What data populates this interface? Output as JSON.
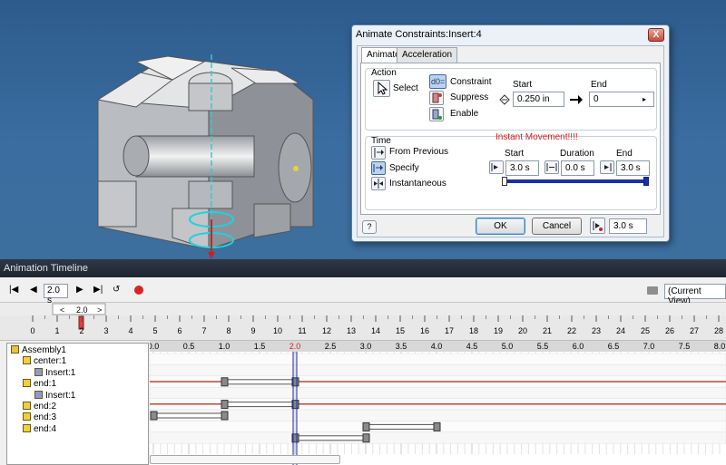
{
  "dialog": {
    "title": "Animate Constraints:Insert:4",
    "close_label": "X",
    "tabs": [
      {
        "label": "Animate"
      },
      {
        "label": "Acceleration"
      }
    ],
    "action": {
      "group_label": "Action",
      "select_label": "Select",
      "options": [
        {
          "label": "Constraint"
        },
        {
          "label": "Suppress"
        },
        {
          "label": "Enable"
        }
      ],
      "constraint_icon_text": "d0=",
      "start_label": "Start",
      "start_value": "0.250 in",
      "end_label": "End",
      "end_value": "0"
    },
    "time": {
      "group_label": "Time",
      "annotation": "Instant Movement!!!!",
      "annotation_color": "#d21f1f",
      "options": [
        {
          "label": "From Previous"
        },
        {
          "label": "Specify"
        },
        {
          "label": "Instantaneous"
        }
      ],
      "start_label": "Start",
      "start_value": "3.0 s",
      "duration_label": "Duration",
      "duration_value": "0.0 s",
      "end_label": "End",
      "end_value": "3.0 s"
    },
    "help_label": "?",
    "ok_label": "OK",
    "cancel_label": "Cancel",
    "footer_time": "3.0 s"
  },
  "timeline": {
    "title": "Animation Timeline",
    "current_time": "2.0 s",
    "view": "(Current View)",
    "ruler": {
      "marker_value": "2.0",
      "left_arrow": "<",
      "right_arrow": ">",
      "ticks": [
        "0",
        "1",
        "2",
        "3",
        "4",
        "5",
        "6",
        "7",
        "8",
        "9",
        "10",
        "11",
        "12",
        "13",
        "14",
        "15",
        "16",
        "17",
        "18",
        "19",
        "20",
        "21",
        "22",
        "23",
        "24",
        "25",
        "26",
        "27",
        "28"
      ]
    },
    "scale_labels": [
      "0.0",
      "0.5",
      "1.0",
      "1.5",
      "2.0",
      "2.5",
      "3.0",
      "3.5",
      "4.0",
      "4.5",
      "5.0",
      "5.5",
      "6.0",
      "6.5",
      "7.0",
      "7.5",
      "8.0"
    ],
    "current_scale_label": "2.0",
    "tree": [
      {
        "label": "Assembly1",
        "level": 0,
        "icon": "assembly-icon"
      },
      {
        "label": "center:1",
        "level": 1,
        "icon": "part-icon"
      },
      {
        "label": "Insert:1",
        "level": 2,
        "icon": "constraint-icon"
      },
      {
        "label": "end:1",
        "level": 1,
        "icon": "part-icon"
      },
      {
        "label": "Insert:1",
        "level": 2,
        "icon": "constraint-icon"
      },
      {
        "label": "end:2",
        "level": 1,
        "icon": "part-icon"
      },
      {
        "label": "end:3",
        "level": 1,
        "icon": "part-icon"
      },
      {
        "label": "end:4",
        "level": 1,
        "icon": "part-icon"
      }
    ],
    "actions": [
      {
        "row": 2,
        "start": 1.0,
        "end": 2.0
      },
      {
        "row": 4,
        "start": 1.0,
        "end": 2.0
      },
      {
        "row": 5,
        "start": 0.0,
        "end": 1.0
      },
      {
        "row": 6,
        "start": 3.0,
        "end": 4.0
      },
      {
        "row": 7,
        "start": 2.0,
        "end": 3.0
      }
    ],
    "current_time_value": 2.0,
    "colors": {
      "playhead": "#1f2f9a",
      "marker": "#cc2a2a",
      "track_line": "#b84a3c"
    }
  }
}
